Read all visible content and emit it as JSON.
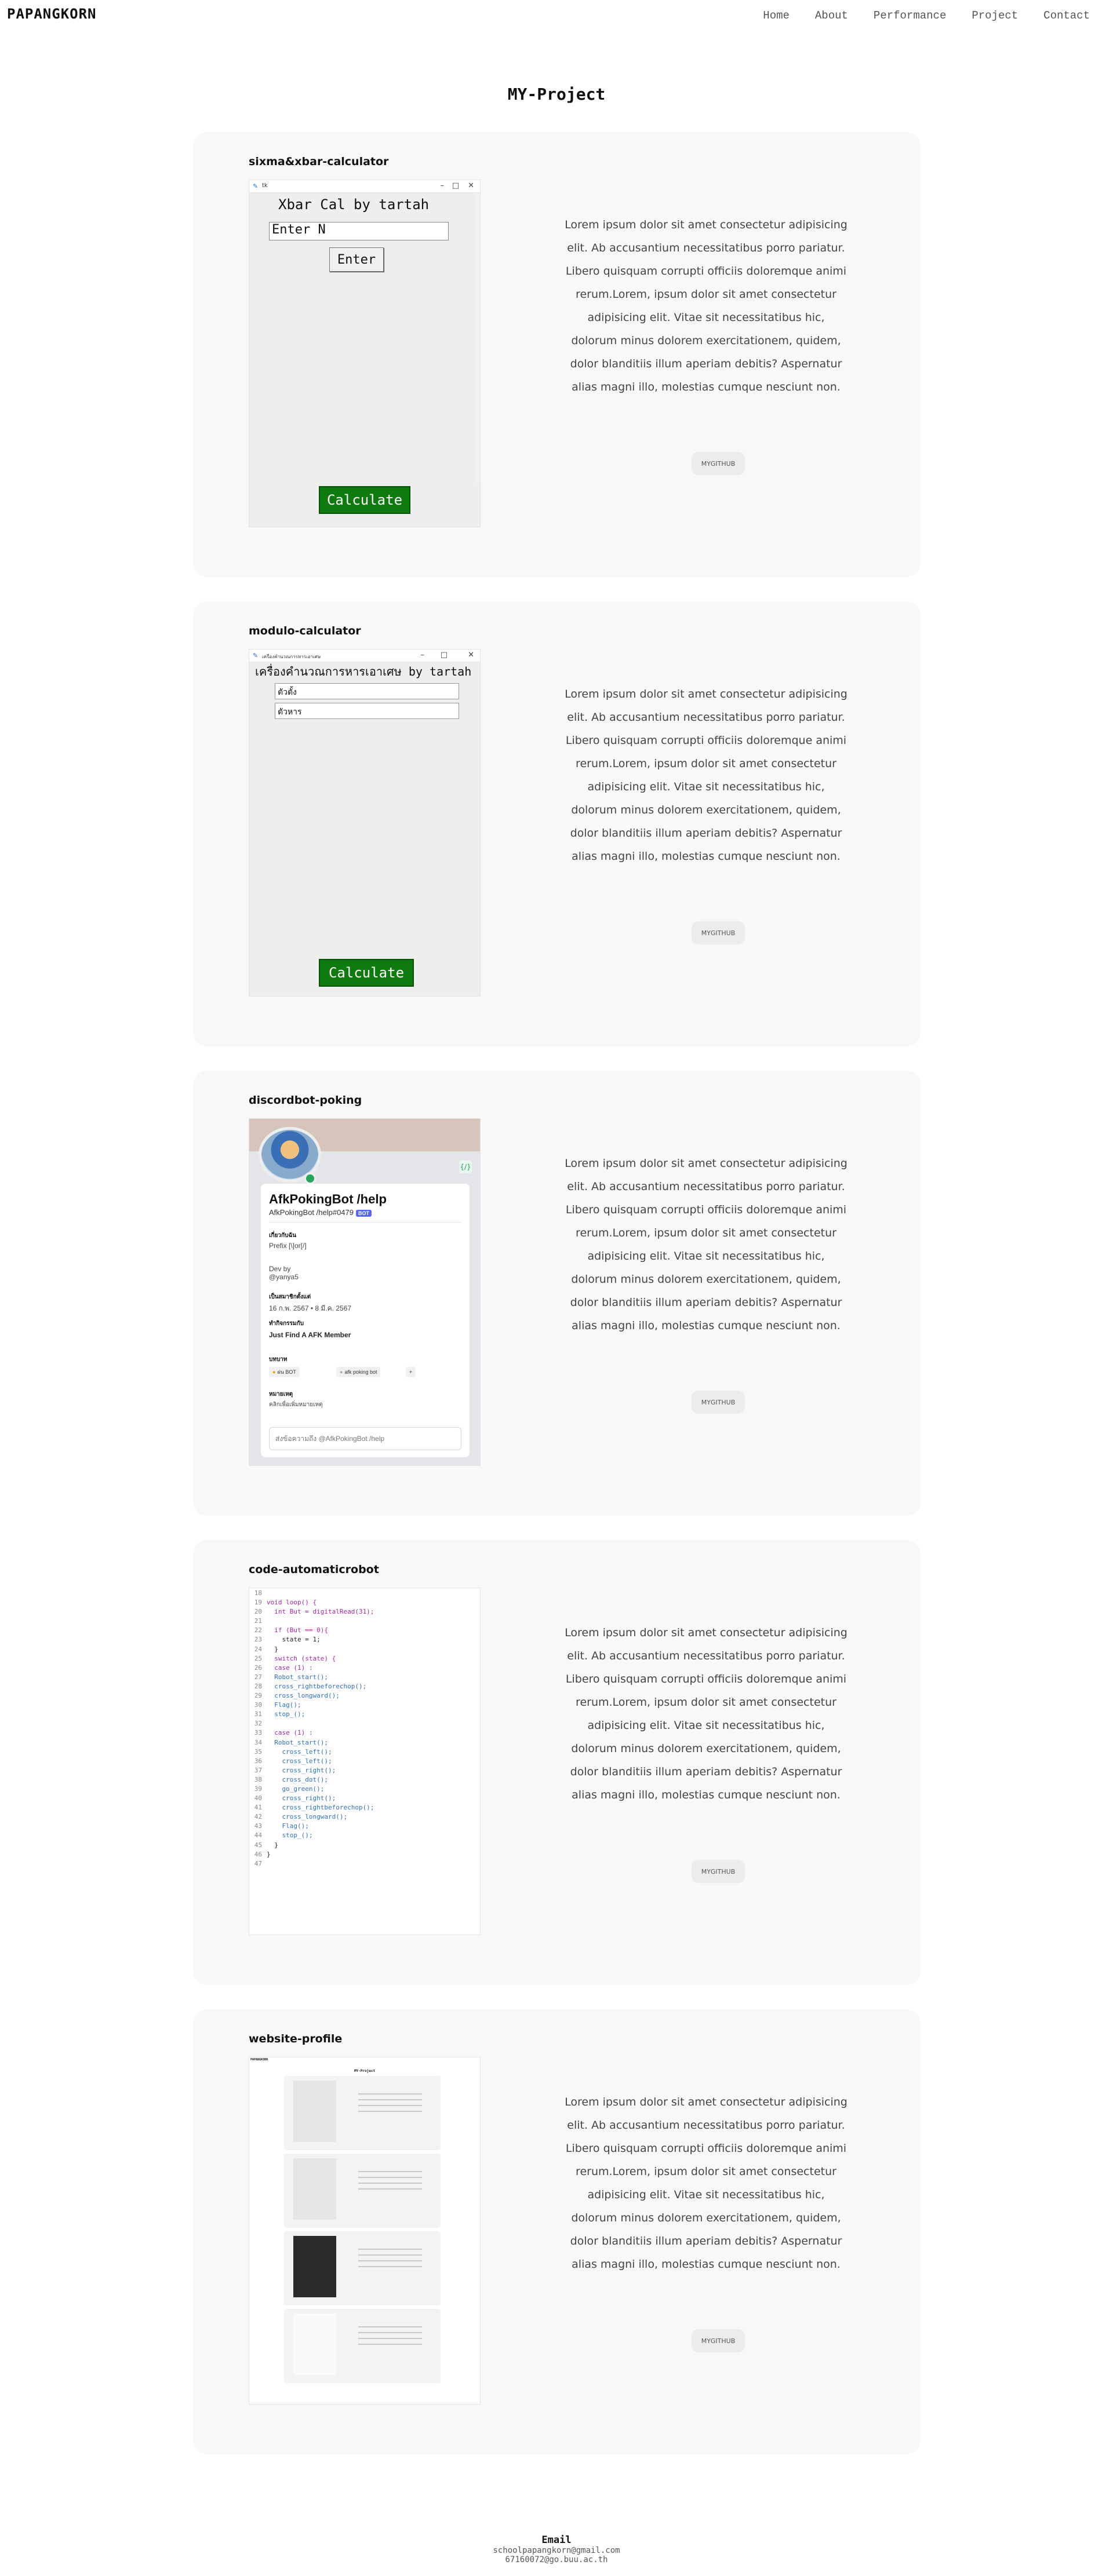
{
  "brand": "PAPANGKORN",
  "nav": [
    "Home",
    "About",
    "Performance",
    "Project",
    "Contact"
  ],
  "page_title": "MY-Project",
  "description": "Lorem ipsum dolor sit amet consectetur adipisicing elit. Ab accusantium necessitatibus porro pariatur. Libero quisquam corrupti officiis doloremque animi rerum.Lorem, ipsum dolor sit amet consectetur adipisicing elit. Vitae sit necessitatibus hic, dolorum minus dolorem exercitationem, quidem, dolor blanditiis illum aperiam debitis? Aspernatur alias magni illo, molestias cumque nesciunt non.",
  "github_label": "MYGITHUB",
  "projects": [
    {
      "title": "sixma&xbar-calculator",
      "window_title": "tk",
      "app_heading": "Xbar Cal by tartah",
      "input_placeholder": "Enter N",
      "enter_label": "Enter",
      "calc_label": "Calculate"
    },
    {
      "title": "modulo-calculator",
      "window_title": "เครื่องคำนวณการหารเอาเศษ",
      "app_heading": "เครื่องคำนวณการหารเอาเศษ by tartah",
      "field1": "ตัวตั้ง",
      "field2": "ตัวหาร",
      "calc_label": "Calculate"
    },
    {
      "title": "discordbot-poking",
      "bot_name": "AfkPokingBot /help",
      "bot_tag": "AfkPokingBot /help#0479",
      "bot_badge": "BOT",
      "slash_icon": "{/}",
      "sec_about": "เกี่ยวกับฉัน",
      "prefix": "Prefix [\\]or[/]",
      "dev_by": "Dev by",
      "dev_handle": "@yanya5",
      "sec_member": "เป็นสมาชิกตั้งแต่",
      "member_dates": "16 ก.พ. 2567  •  8 มี.ค. 2567",
      "sec_role": "ทำกิจกรรมกับ",
      "role_text": "Just Find A AFK Member",
      "sec_roles": "บทบาท",
      "chip1": "ฝน BOT",
      "chip2": "afk poking bot",
      "chip3": "+",
      "sec_note": "หมายเหตุ",
      "note_text": "คลิกเพื่อเพิ่มหมายเหตุ",
      "message_placeholder": "ส่งข้อความถึง @AfkPokingBot /help"
    },
    {
      "title": "code-automaticrobot",
      "code_lines": [
        [
          "18",
          ""
        ],
        [
          "19",
          "void loop() {"
        ],
        [
          "20",
          "  int But = digitalRead(31);"
        ],
        [
          "21",
          ""
        ],
        [
          "22",
          "  if (But == 0){"
        ],
        [
          "23",
          "    state = 1;"
        ],
        [
          "24",
          "  }"
        ],
        [
          "25",
          "  switch (state) {"
        ],
        [
          "26",
          "  case (1) :"
        ],
        [
          "27",
          "  Robot_start();"
        ],
        [
          "28",
          "  cross_rightbeforechop();"
        ],
        [
          "29",
          "  cross_longward();"
        ],
        [
          "30",
          "  Flag();"
        ],
        [
          "31",
          "  stop_();"
        ],
        [
          "32",
          ""
        ],
        [
          "33",
          "  case (1) :"
        ],
        [
          "34",
          "  Robot_start();"
        ],
        [
          "35",
          "    cross_left();"
        ],
        [
          "36",
          "    cross_left();"
        ],
        [
          "37",
          "    cross_right();"
        ],
        [
          "38",
          "    cross_dot();"
        ],
        [
          "39",
          "    go_green();"
        ],
        [
          "40",
          "    cross_right();"
        ],
        [
          "41",
          "    cross_rightbeforechop();"
        ],
        [
          "42",
          "    cross_longward();"
        ],
        [
          "43",
          "    Flag();"
        ],
        [
          "44",
          "    stop_();"
        ],
        [
          "45",
          "  }"
        ],
        [
          "46",
          "}"
        ],
        [
          "47",
          ""
        ]
      ]
    },
    {
      "title": "website-profile",
      "mini_brand": "PAPANGKORN",
      "mini_title": "MY-Project"
    }
  ],
  "footer": {
    "heading": "Email",
    "lines": [
      "schoolpapangkorn@gmail.com",
      "67160072@go.buu.ac.th"
    ]
  },
  "colors": {
    "card_bg": "#f8f8f8",
    "button_green": "#0f7a0f",
    "discord_online": "#23a55a",
    "discord_blurple": "#5865f2"
  }
}
